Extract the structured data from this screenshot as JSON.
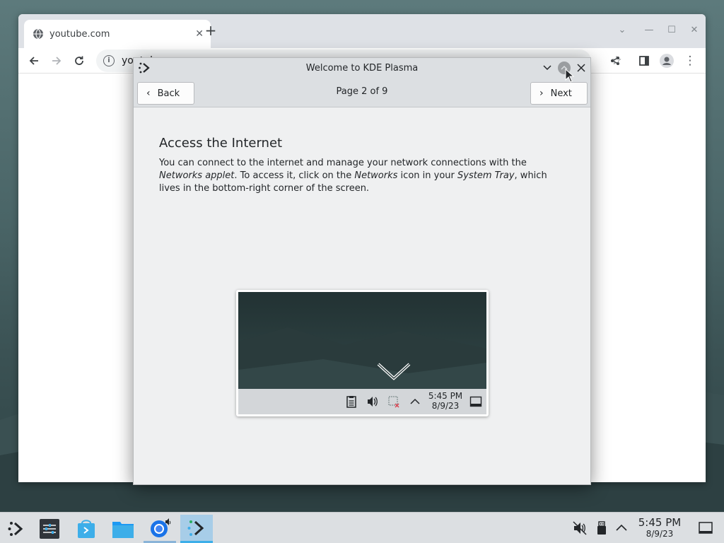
{
  "browser": {
    "tab_title": "youtube.com",
    "tab_close": "✕",
    "new_tab": "+",
    "url": "youtube.com",
    "win_controls": {
      "list": "⌄",
      "minimize": "—",
      "maximize": "☐",
      "close": "✕"
    },
    "nav_icons": {
      "back": "arrow-left-icon",
      "forward": "arrow-right-icon",
      "reload": "reload-icon"
    }
  },
  "dialog": {
    "window_title": "Welcome to KDE Plasma",
    "back_label": "Back",
    "next_label": "Next",
    "page_indicator": "Page 2 of 9",
    "heading": "Access the Internet",
    "body_1": "You can connect to the internet and manage your network connections with the ",
    "body_networks": "Networks",
    "body_applet": "applet",
    "body_2": ". To access it, click on the ",
    "body_networks2": "Networks",
    "body_3": " icon in your ",
    "body_system_tray": "System Tray",
    "body_4": ", which lives in the bottom-right corner of the screen.",
    "illustration": {
      "time": "5:45 PM",
      "date": "8/9/23"
    }
  },
  "panel": {
    "tasks": [
      "kde-launcher-icon",
      "system-settings-icon",
      "discover-icon",
      "dolphin-icon",
      "chrome-icon",
      "welcome-center-icon"
    ],
    "clock_time": "5:45 PM",
    "clock_date": "8/9/23"
  },
  "colors": {
    "accent": "#3daee9",
    "panel": "#dcdfe2",
    "dialog_bg": "#eff0f1"
  }
}
